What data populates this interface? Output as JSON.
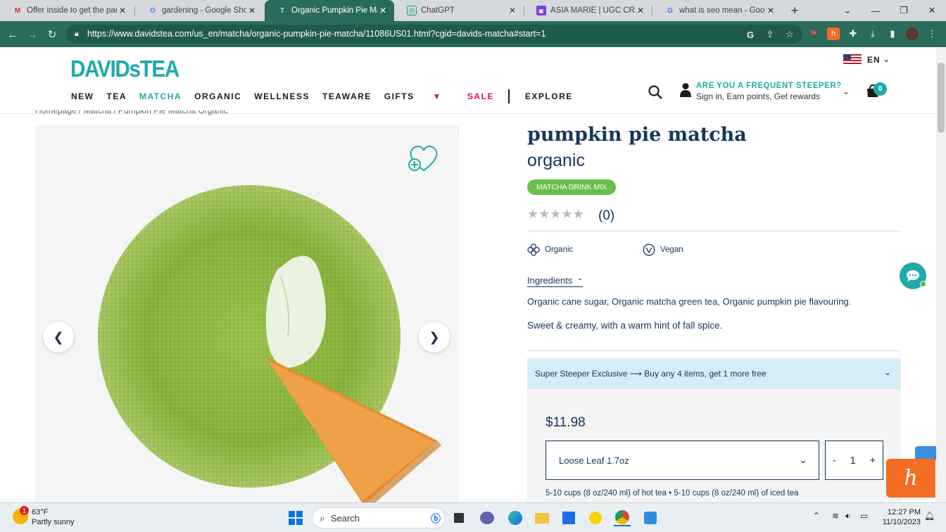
{
  "browser": {
    "tabs": [
      {
        "title": "Offer inside to get the parts",
        "icon": "gmail-icon",
        "active": false
      },
      {
        "title": "gardening - Google Shopping",
        "icon": "google-icon",
        "active": false
      },
      {
        "title": "Organic Pumpkin Pie Matcha",
        "icon": "davidstea-icon",
        "active": true
      },
      {
        "title": "ChatGPT",
        "icon": "chatgpt-icon",
        "active": false
      },
      {
        "title": "ASIA MARIE | UGC CREATOR",
        "icon": "canva-icon",
        "active": false
      },
      {
        "title": "what is seo mean - Google Search",
        "icon": "google-icon",
        "active": false
      }
    ],
    "url": "https://www.davidstea.com/us_en/matcha/organic-pumpkin-pie-matcha/11086US01.html?cgid=davids-matcha#start=1"
  },
  "site": {
    "logo": "DAVIDsTEA",
    "language": "EN",
    "nav": [
      "NEW",
      "TEA",
      "MATCHA",
      "ORGANIC",
      "WELLNESS",
      "TEAWARE",
      "GIFTS",
      "SALE",
      "EXPLORE"
    ],
    "account_title": "ARE YOU A FREQUENT STEEPER?",
    "account_sub": "Sign in, Earn points, Get rewards",
    "cart_count": "0"
  },
  "breadcrumb": "Homepage /  Matcha /  Pumpkin Pie Matcha Organic",
  "product": {
    "name": "pumpkin pie matcha",
    "subtitle": "organic",
    "badge": "MATCHA DRINK MIX",
    "stars": "★★★★★",
    "rating_value": 0,
    "reviews": "(0)",
    "attributes": [
      "Organic",
      "Vegan"
    ],
    "ingredients_label": "Ingredients",
    "ingredients": "Organic cane sugar, Organic matcha green tea, Organic pumpkin pie flavouring.",
    "description": "Sweet & creamy, with a warm hint of fall spice.",
    "promo": "Super Steeper Exclusive ⟶ Buy any 4 items, get 1 more free",
    "price": "$11.98",
    "size": "Loose Leaf 1.7oz",
    "qty_minus": "-",
    "qty": "1",
    "qty_plus": "+",
    "cups": "5-10 cups (8 oz/240 ml) of hot tea  •  5-10 cups (8 oz/240 ml) of iced tea"
  },
  "taskbar": {
    "temp": "63°F",
    "condition": "Partly sunny",
    "weather_badge": "1",
    "search": "Search",
    "time": "12:27 PM",
    "date": "11/10/2023"
  },
  "colors": {
    "brand_teal": "#1eaaa8",
    "navy": "#16365c",
    "sale_red": "#e0133c",
    "badge_green": "#6abf4b",
    "browser_chrome": "#2b6b5e"
  }
}
